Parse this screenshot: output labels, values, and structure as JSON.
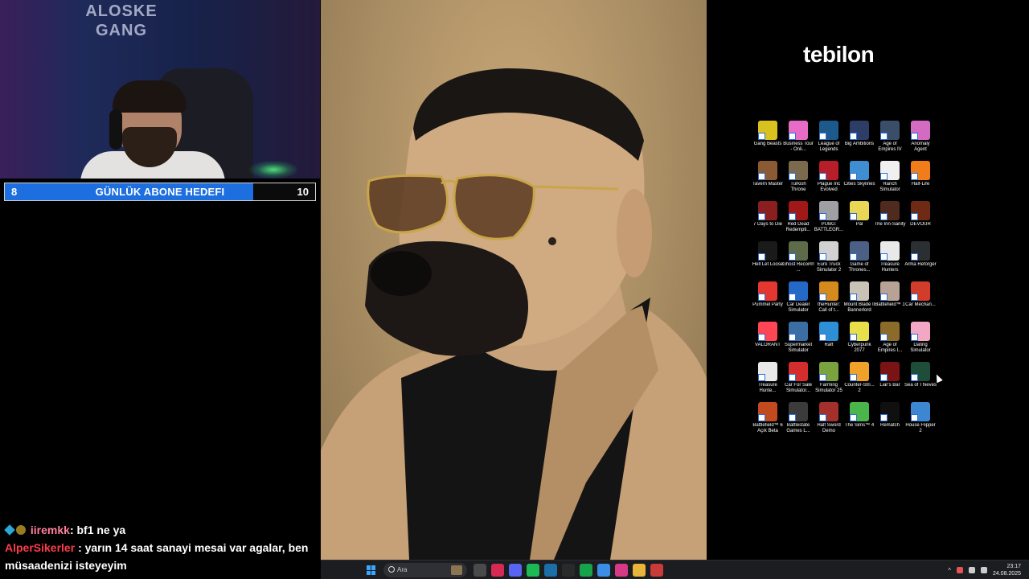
{
  "webcam": {
    "wall_text_line1": "ALOSKE",
    "wall_text_line2": "GANG"
  },
  "sub_goal": {
    "current": "8",
    "title": "GÜNLÜK ABONE HEDEFI",
    "target": "10",
    "progress": 0.8,
    "fill_color": "#1d6fe0"
  },
  "chat": {
    "messages": [
      {
        "user": "iiremkk",
        "text": ": bf1 ne ya",
        "user_color": "#ff7f9d"
      },
      {
        "user": "AlperSikerler",
        "text": ": yarın 14 saat sanayi mesai var agalar, ben müsaadenizi isteyeyim",
        "user_color": "#ff3b4a"
      }
    ]
  },
  "desktop": {
    "brand": "tebilon",
    "icons": [
      {
        "label": "Gang Beasts",
        "color": "#d9c21e",
        "icon": "gang-beasts-icon"
      },
      {
        "label": "Business Tour - Onli...",
        "color": "#e86cc7",
        "icon": "business-tour-icon"
      },
      {
        "label": "League of Legends",
        "color": "#1d5a8c",
        "icon": "league-of-legends-icon"
      },
      {
        "label": "Big Ambitions",
        "color": "#2d3d68",
        "icon": "big-ambitions-icon"
      },
      {
        "label": "Age of Empires IV",
        "color": "#3a4e6a",
        "icon": "age-of-empires-iv-icon"
      },
      {
        "label": "Anomaly Agent",
        "color": "#d36bc3",
        "icon": "anomaly-agent-icon"
      },
      {
        "label": "Tavern Master",
        "color": "#8a5a34",
        "icon": "tavern-master-icon"
      },
      {
        "label": "Turkish Throne",
        "color": "#7b6a4e",
        "icon": "turkish-throne-icon"
      },
      {
        "label": "Plague Inc Evolved",
        "color": "#b81d2a",
        "icon": "plague-inc-icon"
      },
      {
        "label": "Cities Skylines",
        "color": "#3f8ed1",
        "icon": "cities-skylines-icon"
      },
      {
        "label": "Ranch Simulator",
        "color": "#f0f0f0",
        "icon": "ranch-simulator-icon"
      },
      {
        "label": "Half-Life",
        "color": "#f07c1a",
        "icon": "half-life-icon"
      },
      {
        "label": "7 Days to Die",
        "color": "#8b1f1f",
        "icon": "7-days-to-die-icon"
      },
      {
        "label": "Red Dead Redempti...",
        "color": "#a01818",
        "icon": "red-dead-icon"
      },
      {
        "label": "PUBG: BATTLEGR...",
        "color": "#9ea0a3",
        "icon": "pubg-icon"
      },
      {
        "label": "Pal",
        "color": "#e8d654",
        "icon": "pal-icon"
      },
      {
        "label": "The Inn-Sanity",
        "color": "#4e2b1e",
        "icon": "inn-sanity-icon"
      },
      {
        "label": "DEVOUR",
        "color": "#6e2a12",
        "icon": "devour-icon"
      },
      {
        "label": "Hell Let Loose",
        "color": "#1a1a1a",
        "icon": "hell-let-loose-icon"
      },
      {
        "label": "Ghost Recon® ...",
        "color": "#5d6b4a",
        "icon": "ghost-recon-icon"
      },
      {
        "label": "Euro Truck Simulator 2",
        "color": "#d1d1d1",
        "icon": "euro-truck-icon"
      },
      {
        "label": "Game of Thrones...",
        "color": "#4c5f84",
        "icon": "game-of-thrones-icon"
      },
      {
        "label": "Treasure Hunters",
        "color": "#e9e9e9",
        "icon": "treasure-hunters-icon"
      },
      {
        "label": "Arma Reforger",
        "color": "#2b2f33",
        "icon": "arma-reforger-icon"
      },
      {
        "label": "Pummel Party",
        "color": "#e4372f",
        "icon": "pummel-party-icon"
      },
      {
        "label": "Car Dealer Simulator",
        "color": "#2469c8",
        "icon": "car-dealer-icon"
      },
      {
        "label": "theHunter: Call of t...",
        "color": "#d48a1c",
        "icon": "thehunter-icon"
      },
      {
        "label": "Mount Blade II Bannerlord",
        "color": "#c9c3b7",
        "icon": "bannerlord-icon"
      },
      {
        "label": "Battlefield™ 1",
        "color": "#b7a295",
        "icon": "battlefield-1-icon"
      },
      {
        "label": "Car Mechan...",
        "color": "#d23c2a",
        "icon": "car-mechanic-icon"
      },
      {
        "label": "VALORANT",
        "color": "#ff4655",
        "icon": "valorant-icon"
      },
      {
        "label": "Supermarket Simulator",
        "color": "#3b6fa3",
        "icon": "supermarket-simulator-icon"
      },
      {
        "label": "Raft",
        "color": "#2d8fd6",
        "icon": "raft-icon"
      },
      {
        "label": "Cyberpunk 2077",
        "color": "#e8e04a",
        "icon": "cyberpunk-icon"
      },
      {
        "label": "Age of Empires I...",
        "color": "#8a6b2a",
        "icon": "age-of-empires-ii-icon"
      },
      {
        "label": "Dating Simulator",
        "color": "#f2a8c4",
        "icon": "dating-simulator-icon"
      },
      {
        "label": "Treasure Hunte...",
        "color": "#e9e9e9",
        "icon": "treasure-hunter-2-icon"
      },
      {
        "label": "Car For Sale Simulator...",
        "color": "#d42d2d",
        "icon": "car-for-sale-icon"
      },
      {
        "label": "Farming Simulator 25",
        "color": "#7aa23e",
        "icon": "farming-simulator-icon"
      },
      {
        "label": "Counter-Stri... 2",
        "color": "#f0a12a",
        "icon": "counter-strike-icon"
      },
      {
        "label": "Liar's Bar",
        "color": "#7a1414",
        "icon": "liars-bar-icon"
      },
      {
        "label": "Sea of Thieves",
        "color": "#1e4d3a",
        "icon": "sea-of-thieves-icon"
      },
      {
        "label": "Battlefield™ 6 Açık Beta",
        "color": "#c24a1e",
        "icon": "battlefield-6-icon"
      },
      {
        "label": "Battlestate Games L...",
        "color": "#3b3b3b",
        "icon": "battlestate-icon"
      },
      {
        "label": "Half Sword Demo",
        "color": "#a3302a",
        "icon": "half-sword-icon"
      },
      {
        "label": "The Sims™ 4",
        "color": "#4ab54a",
        "icon": "the-sims-icon"
      },
      {
        "label": "Rematch",
        "color": "#101010",
        "icon": "rematch-icon"
      },
      {
        "label": "House Flipper 2",
        "color": "#3d86d1",
        "icon": "house-flipper-icon"
      }
    ]
  },
  "taskbar": {
    "search_placeholder": "Ara",
    "apps": [
      {
        "icon": "file-explorer-icon",
        "color": "#4a4a4a"
      },
      {
        "icon": "opera-gx-icon",
        "color": "#d62a55"
      },
      {
        "icon": "discord-icon",
        "color": "#5865f2"
      },
      {
        "icon": "spotify-icon",
        "color": "#1db954"
      },
      {
        "icon": "steam-icon",
        "color": "#1b6ea8"
      },
      {
        "icon": "epic-games-icon",
        "color": "#2a2a2a"
      },
      {
        "icon": "xbox-icon",
        "color": "#17a34a"
      },
      {
        "icon": "copilot-icon",
        "color": "#3a8ee8"
      },
      {
        "icon": "instagram-icon",
        "color": "#d63a87"
      },
      {
        "icon": "folder-icon",
        "color": "#e8b43a"
      },
      {
        "icon": "chrome-icon",
        "color": "#c93a3a"
      }
    ],
    "time": "23:17",
    "date": "24.08.2025"
  }
}
